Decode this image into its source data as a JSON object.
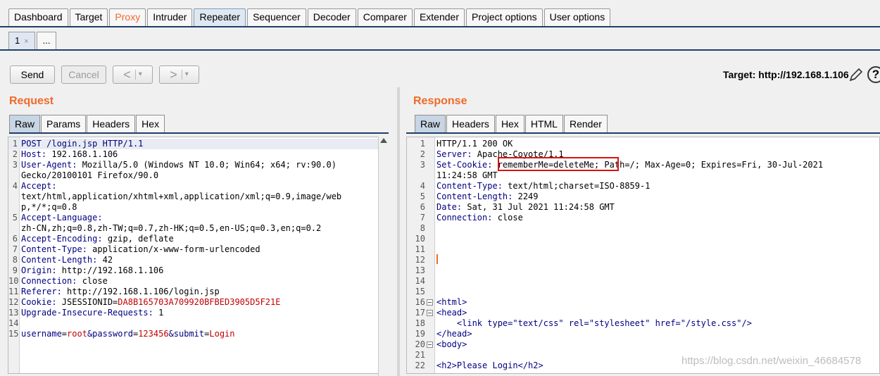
{
  "main_tabs": [
    {
      "label": "Dashboard"
    },
    {
      "label": "Target"
    },
    {
      "label": "Proxy"
    },
    {
      "label": "Intruder"
    },
    {
      "label": "Repeater"
    },
    {
      "label": "Sequencer"
    },
    {
      "label": "Decoder"
    },
    {
      "label": "Comparer"
    },
    {
      "label": "Extender"
    },
    {
      "label": "Project options"
    },
    {
      "label": "User options"
    }
  ],
  "sub_tabs": {
    "tab1": "1",
    "close": "×",
    "more": "..."
  },
  "toolbar": {
    "send": "Send",
    "cancel": "Cancel",
    "back": "<",
    "forward": ">",
    "dropdown": "▾"
  },
  "target_label": "Target: http://192.168.1.106",
  "help_label": "?",
  "request": {
    "title": "Request",
    "tabs": [
      "Raw",
      "Params",
      "Headers",
      "Hex"
    ],
    "lines": [
      {
        "n": "1",
        "k": "POST /login.jsp HTTP/1.1",
        "v": ""
      },
      {
        "n": "2",
        "k": "Host:",
        "v": " 192.168.1.106"
      },
      {
        "n": "3",
        "k": "User-Agent:",
        "v": " Mozilla/5.0 (Windows NT 10.0; Win64; x64; rv:90.0)"
      },
      {
        "n": "",
        "k": "",
        "v": "Gecko/20100101 Firefox/90.0"
      },
      {
        "n": "4",
        "k": "Accept:",
        "v": ""
      },
      {
        "n": "",
        "k": "",
        "v": "text/html,application/xhtml+xml,application/xml;q=0.9,image/web"
      },
      {
        "n": "",
        "k": "",
        "v": "p,*/*;q=0.8"
      },
      {
        "n": "5",
        "k": "Accept-Language:",
        "v": ""
      },
      {
        "n": "",
        "k": "",
        "v": "zh-CN,zh;q=0.8,zh-TW;q=0.7,zh-HK;q=0.5,en-US;q=0.3,en;q=0.2"
      },
      {
        "n": "6",
        "k": "Accept-Encoding:",
        "v": " gzip, deflate"
      },
      {
        "n": "7",
        "k": "Content-Type:",
        "v": " application/x-www-form-urlencoded"
      },
      {
        "n": "8",
        "k": "Content-Length:",
        "v": " 42"
      },
      {
        "n": "9",
        "k": "Origin:",
        "v": " http://192.168.1.106"
      },
      {
        "n": "10",
        "k": "Connection:",
        "v": " close"
      },
      {
        "n": "11",
        "k": "Referer:",
        "v": " http://192.168.1.106/login.jsp"
      },
      {
        "n": "12",
        "k": "Cookie:",
        "v": " JSESSIONID=",
        "c": "DA8B165703A709920BFBED3905D5F21E"
      },
      {
        "n": "13",
        "k": "Upgrade-Insecure-Requests:",
        "v": " 1"
      },
      {
        "n": "14",
        "k": "",
        "v": ""
      },
      {
        "n": "15",
        "k": "username",
        "v": "=",
        "c": "root",
        "k2": "&password",
        "v2": "=",
        "c2": "123456",
        "k3": "&submit",
        "v3": "=",
        "c3": "Login"
      }
    ]
  },
  "response": {
    "title": "Response",
    "tabs": [
      "Raw",
      "Headers",
      "Hex",
      "HTML",
      "Render"
    ],
    "lines": [
      {
        "n": "1",
        "k": "",
        "v": "HTTP/1.1 200 OK"
      },
      {
        "n": "2",
        "k": "Server:",
        "v": " Apache-Coyote/1.1"
      },
      {
        "n": "3",
        "k": "Set-Cookie:",
        "v": " rememberMe=deleteMe; Path=/; Max-Age=0; Expires=Fri, 30-Jul-2021"
      },
      {
        "n": "",
        "k": "",
        "v": "11:24:58 GMT"
      },
      {
        "n": "4",
        "k": "Content-Type:",
        "v": " text/html;charset=ISO-8859-1"
      },
      {
        "n": "5",
        "k": "Content-Length:",
        "v": " 2249"
      },
      {
        "n": "6",
        "k": "Date:",
        "v": " Sat, 31 Jul 2021 11:24:58 GMT"
      },
      {
        "n": "7",
        "k": "Connection:",
        "v": " close"
      },
      {
        "n": "8",
        "k": "",
        "v": ""
      },
      {
        "n": "10",
        "k": "",
        "v": ""
      },
      {
        "n": "11",
        "k": "",
        "v": ""
      },
      {
        "n": "12",
        "k": "",
        "v": ""
      },
      {
        "n": "13",
        "k": "",
        "v": ""
      },
      {
        "n": "14",
        "k": "",
        "v": ""
      },
      {
        "n": "15",
        "k": "",
        "v": ""
      },
      {
        "n": "16",
        "k": "<html>",
        "v": "",
        "fold": true
      },
      {
        "n": "17",
        "k": "<head>",
        "v": "",
        "fold": true
      },
      {
        "n": "18",
        "k": "    <link type=\"text/css\" rel=\"stylesheet\" href=\"/style.css\"/>",
        "v": ""
      },
      {
        "n": "19",
        "k": "</head>",
        "v": ""
      },
      {
        "n": "20",
        "k": "<body>",
        "v": "",
        "fold": true
      },
      {
        "n": "21",
        "k": "",
        "v": ""
      },
      {
        "n": "22",
        "k": "<h2>Please Login</h2>",
        "v": ""
      }
    ]
  },
  "watermark": "https://blog.csdn.net/weixin_46684578"
}
